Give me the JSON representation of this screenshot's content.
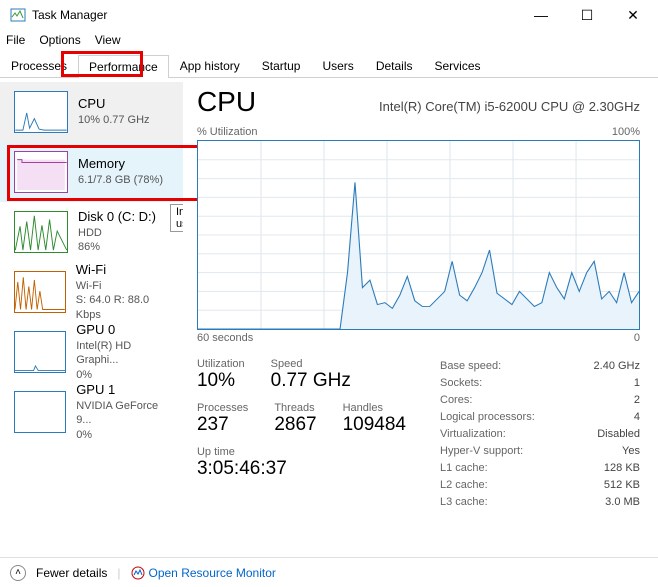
{
  "window": {
    "title": "Task Manager"
  },
  "menu": {
    "file": "File",
    "options": "Options",
    "view": "View"
  },
  "tabs": {
    "processes": "Processes",
    "performance": "Performance",
    "apphistory": "App history",
    "startup": "Startup",
    "users": "Users",
    "details": "Details",
    "services": "Services"
  },
  "sidebar": [
    {
      "name": "CPU",
      "sub": "10% 0.77 GHz",
      "sub2": "",
      "selected": true,
      "color": "#2b7bba"
    },
    {
      "name": "Memory",
      "sub": "6.1/7.8 GB (78%)",
      "sub2": "",
      "hovered": true,
      "color": "#a040a0"
    },
    {
      "name": "Disk 0 (C: D:)",
      "sub": "HDD",
      "sub2": "86%",
      "color": "#2e8b2e"
    },
    {
      "name": "Wi-Fi",
      "sub": "Wi-Fi",
      "sub2": "S: 64.0 R: 88.0 Kbps",
      "color": "#c06000"
    },
    {
      "name": "GPU 0",
      "sub": "Intel(R) HD Graphi...",
      "sub2": "0%",
      "color": "#2b7bba"
    },
    {
      "name": "GPU 1",
      "sub": "NVIDIA GeForce 9...",
      "sub2": "0%",
      "color": "#2b7bba"
    }
  ],
  "tooltip": "In use",
  "detail": {
    "title": "CPU",
    "model": "Intel(R) Core(TM) i5-6200U CPU @ 2.30GHz",
    "ylabel": "% Utilization",
    "ymax": "100%",
    "xlabel": "60 seconds",
    "xmin": "0"
  },
  "stats_left": {
    "util_label": "Utilization",
    "util": "10%",
    "speed_label": "Speed",
    "speed": "0.77 GHz",
    "proc_label": "Processes",
    "proc": "237",
    "thr_label": "Threads",
    "thr": "2867",
    "hnd_label": "Handles",
    "hnd": "109484",
    "up_label": "Up time",
    "up": "3:05:46:37"
  },
  "stats_right": {
    "base_k": "Base speed:",
    "base_v": "2.40 GHz",
    "sock_k": "Sockets:",
    "sock_v": "1",
    "core_k": "Cores:",
    "core_v": "2",
    "lp_k": "Logical processors:",
    "lp_v": "4",
    "virt_k": "Virtualization:",
    "virt_v": "Disabled",
    "hv_k": "Hyper-V support:",
    "hv_v": "Yes",
    "l1_k": "L1 cache:",
    "l1_v": "128 KB",
    "l2_k": "L2 cache:",
    "l2_v": "512 KB",
    "l3_k": "L3 cache:",
    "l3_v": "3.0 MB"
  },
  "footer": {
    "fewer": "Fewer details",
    "orm": "Open Resource Monitor"
  },
  "chart_data": {
    "type": "line",
    "title": "% Utilization",
    "xlabel": "60 seconds",
    "ylabel": "% Utilization",
    "ylim": [
      0,
      100
    ],
    "x": [
      0,
      1,
      2,
      3,
      4,
      5,
      6,
      7,
      8,
      9,
      10,
      11,
      12,
      13,
      14,
      15,
      16,
      17,
      18,
      19,
      20,
      21,
      22,
      23,
      24,
      25,
      26,
      27,
      28,
      29,
      30,
      31,
      32,
      33,
      34,
      35,
      36,
      37,
      38,
      39,
      40,
      41,
      42,
      43,
      44,
      45,
      46,
      47,
      48,
      49,
      50,
      51,
      52,
      53,
      54,
      55,
      56,
      57,
      58,
      59
    ],
    "values": [
      0,
      0,
      0,
      0,
      0,
      0,
      0,
      0,
      0,
      0,
      0,
      0,
      0,
      0,
      0,
      0,
      0,
      0,
      0,
      0,
      30,
      78,
      22,
      26,
      13,
      14,
      11,
      18,
      28,
      15,
      12,
      12,
      16,
      20,
      36,
      18,
      15,
      22,
      30,
      42,
      19,
      16,
      13,
      20,
      16,
      12,
      14,
      30,
      22,
      16,
      30,
      20,
      30,
      36,
      16,
      20,
      14,
      30,
      14,
      20
    ]
  }
}
